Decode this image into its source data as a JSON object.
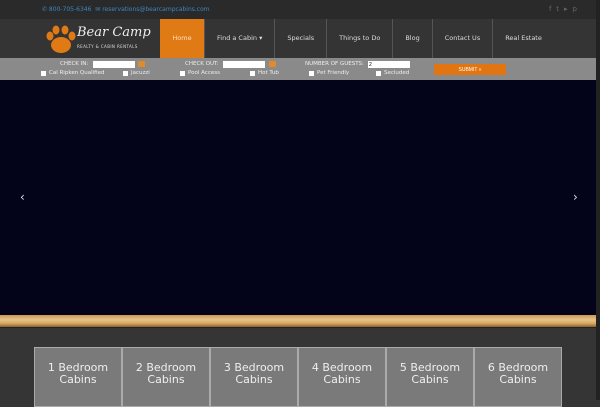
{
  "topbar": {
    "phone": "✆ 800-705-6346",
    "email": "✉ reservations@bearcampcabins.com",
    "social": [
      "f",
      "t",
      "▸",
      "p"
    ]
  },
  "logo": {
    "name": "Bear Camp",
    "tagline": "REALTY & CABIN RENTALS"
  },
  "menu": [
    {
      "label": "Home"
    },
    {
      "label": "Find a Cabin ▾"
    },
    {
      "label": "Specials"
    },
    {
      "label": "Things to Do"
    },
    {
      "label": "Blog"
    },
    {
      "label": "Contact Us"
    },
    {
      "label": "Real Estate"
    }
  ],
  "search": {
    "check_in": "CHECK IN:",
    "check_out": "CHECK OUT:",
    "guests": "NUMBER OF GUESTS:",
    "guests_value": "2",
    "submit": "SUBMIT »",
    "amenities": [
      "Cal Ripken Qualified",
      "Jacuzzi",
      "Pool Access",
      "Hot Tub",
      "Pet Friendly",
      "Secluded"
    ]
  },
  "slider": {
    "prev": "‹",
    "next": "›"
  },
  "cabins": [
    {
      "l1": "1 Bedroom",
      "l2": "Cabins"
    },
    {
      "l1": "2 Bedroom",
      "l2": "Cabins"
    },
    {
      "l1": "3 Bedroom",
      "l2": "Cabins"
    },
    {
      "l1": "4 Bedroom",
      "l2": "Cabins"
    },
    {
      "l1": "5 Bedroom",
      "l2": "Cabins"
    },
    {
      "l1": "6 Bedroom",
      "l2": "Cabins"
    }
  ]
}
